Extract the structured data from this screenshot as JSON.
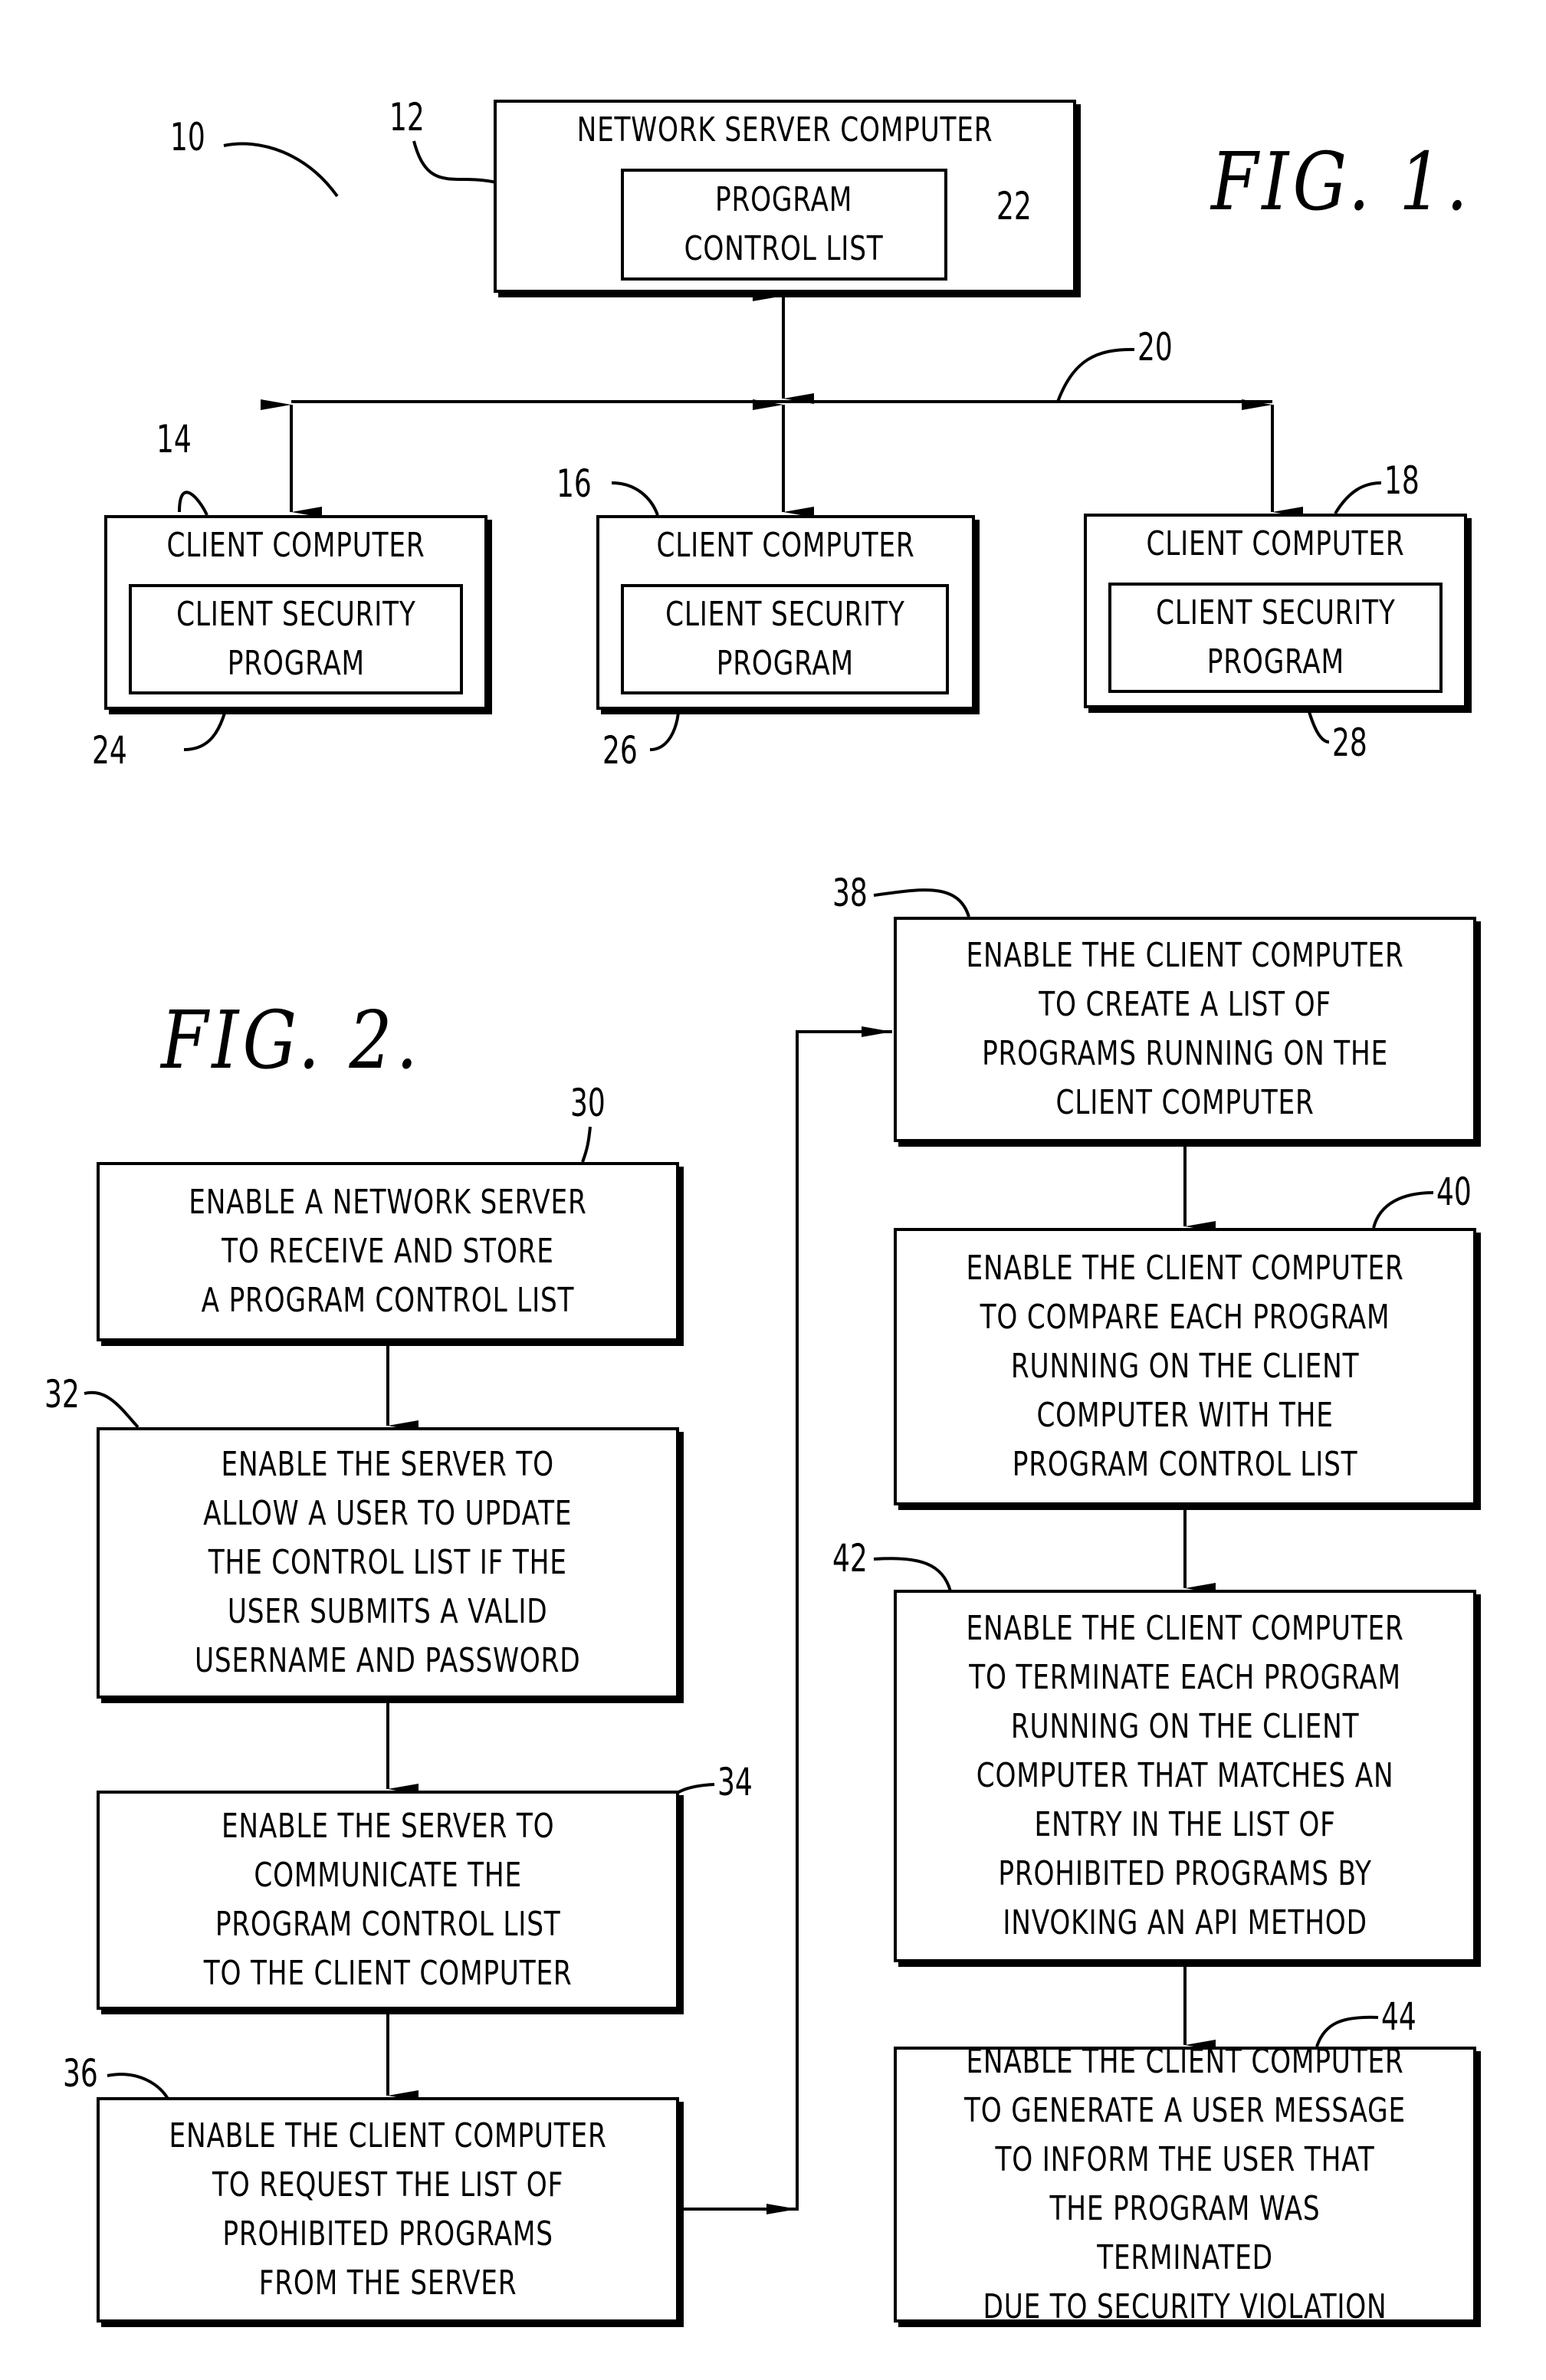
{
  "fig1": {
    "label": "FIG. 1.",
    "system_ref": "10",
    "server": {
      "ref": "12",
      "title": "NETWORK SERVER COMPUTER",
      "inner_ref": "22",
      "inner_label": "PROGRAM\nCONTROL LIST"
    },
    "network_ref": "20",
    "clients": [
      {
        "ref": "14",
        "title": "CLIENT COMPUTER",
        "inner_ref": "24",
        "inner_label": "CLIENT SECURITY\nPROGRAM"
      },
      {
        "ref": "16",
        "title": "CLIENT COMPUTER",
        "inner_ref": "26",
        "inner_label": "CLIENT SECURITY\nPROGRAM"
      },
      {
        "ref": "18",
        "title": "CLIENT COMPUTER",
        "inner_ref": "28",
        "inner_label": "CLIENT SECURITY\nPROGRAM"
      }
    ]
  },
  "fig2": {
    "label": "FIG. 2.",
    "steps": [
      {
        "ref": "30",
        "text": "ENABLE A NETWORK SERVER\nTO RECEIVE AND STORE\nA PROGRAM CONTROL LIST"
      },
      {
        "ref": "32",
        "text": "ENABLE THE SERVER TO\nALLOW A USER TO UPDATE\nTHE CONTROL LIST IF THE\nUSER SUBMITS A VALID\nUSERNAME AND PASSWORD"
      },
      {
        "ref": "34",
        "text": "ENABLE THE SERVER TO\nCOMMUNICATE THE\nPROGRAM CONTROL LIST\nTO THE CLIENT COMPUTER"
      },
      {
        "ref": "36",
        "text": "ENABLE THE CLIENT COMPUTER\nTO REQUEST THE LIST OF\nPROHIBITED PROGRAMS\nFROM THE SERVER"
      },
      {
        "ref": "38",
        "text": "ENABLE THE CLIENT COMPUTER\nTO CREATE A LIST OF\nPROGRAMS RUNNING ON THE\nCLIENT COMPUTER"
      },
      {
        "ref": "40",
        "text": "ENABLE THE CLIENT COMPUTER\nTO COMPARE EACH PROGRAM\nRUNNING ON THE CLIENT\nCOMPUTER WITH THE\nPROGRAM CONTROL LIST"
      },
      {
        "ref": "42",
        "text": "ENABLE THE CLIENT COMPUTER\nTO TERMINATE EACH PROGRAM\nRUNNING ON THE CLIENT\nCOMPUTER THAT MATCHES AN\nENTRY IN THE LIST OF\nPROHIBITED PROGRAMS BY\nINVOKING AN API METHOD"
      },
      {
        "ref": "44",
        "text": "ENABLE THE CLIENT COMPUTER\nTO GENERATE A USER MESSAGE\nTO INFORM THE USER THAT\nTHE PROGRAM WAS TERMINATED\nDUE TO SECURITY VIOLATION"
      }
    ]
  }
}
